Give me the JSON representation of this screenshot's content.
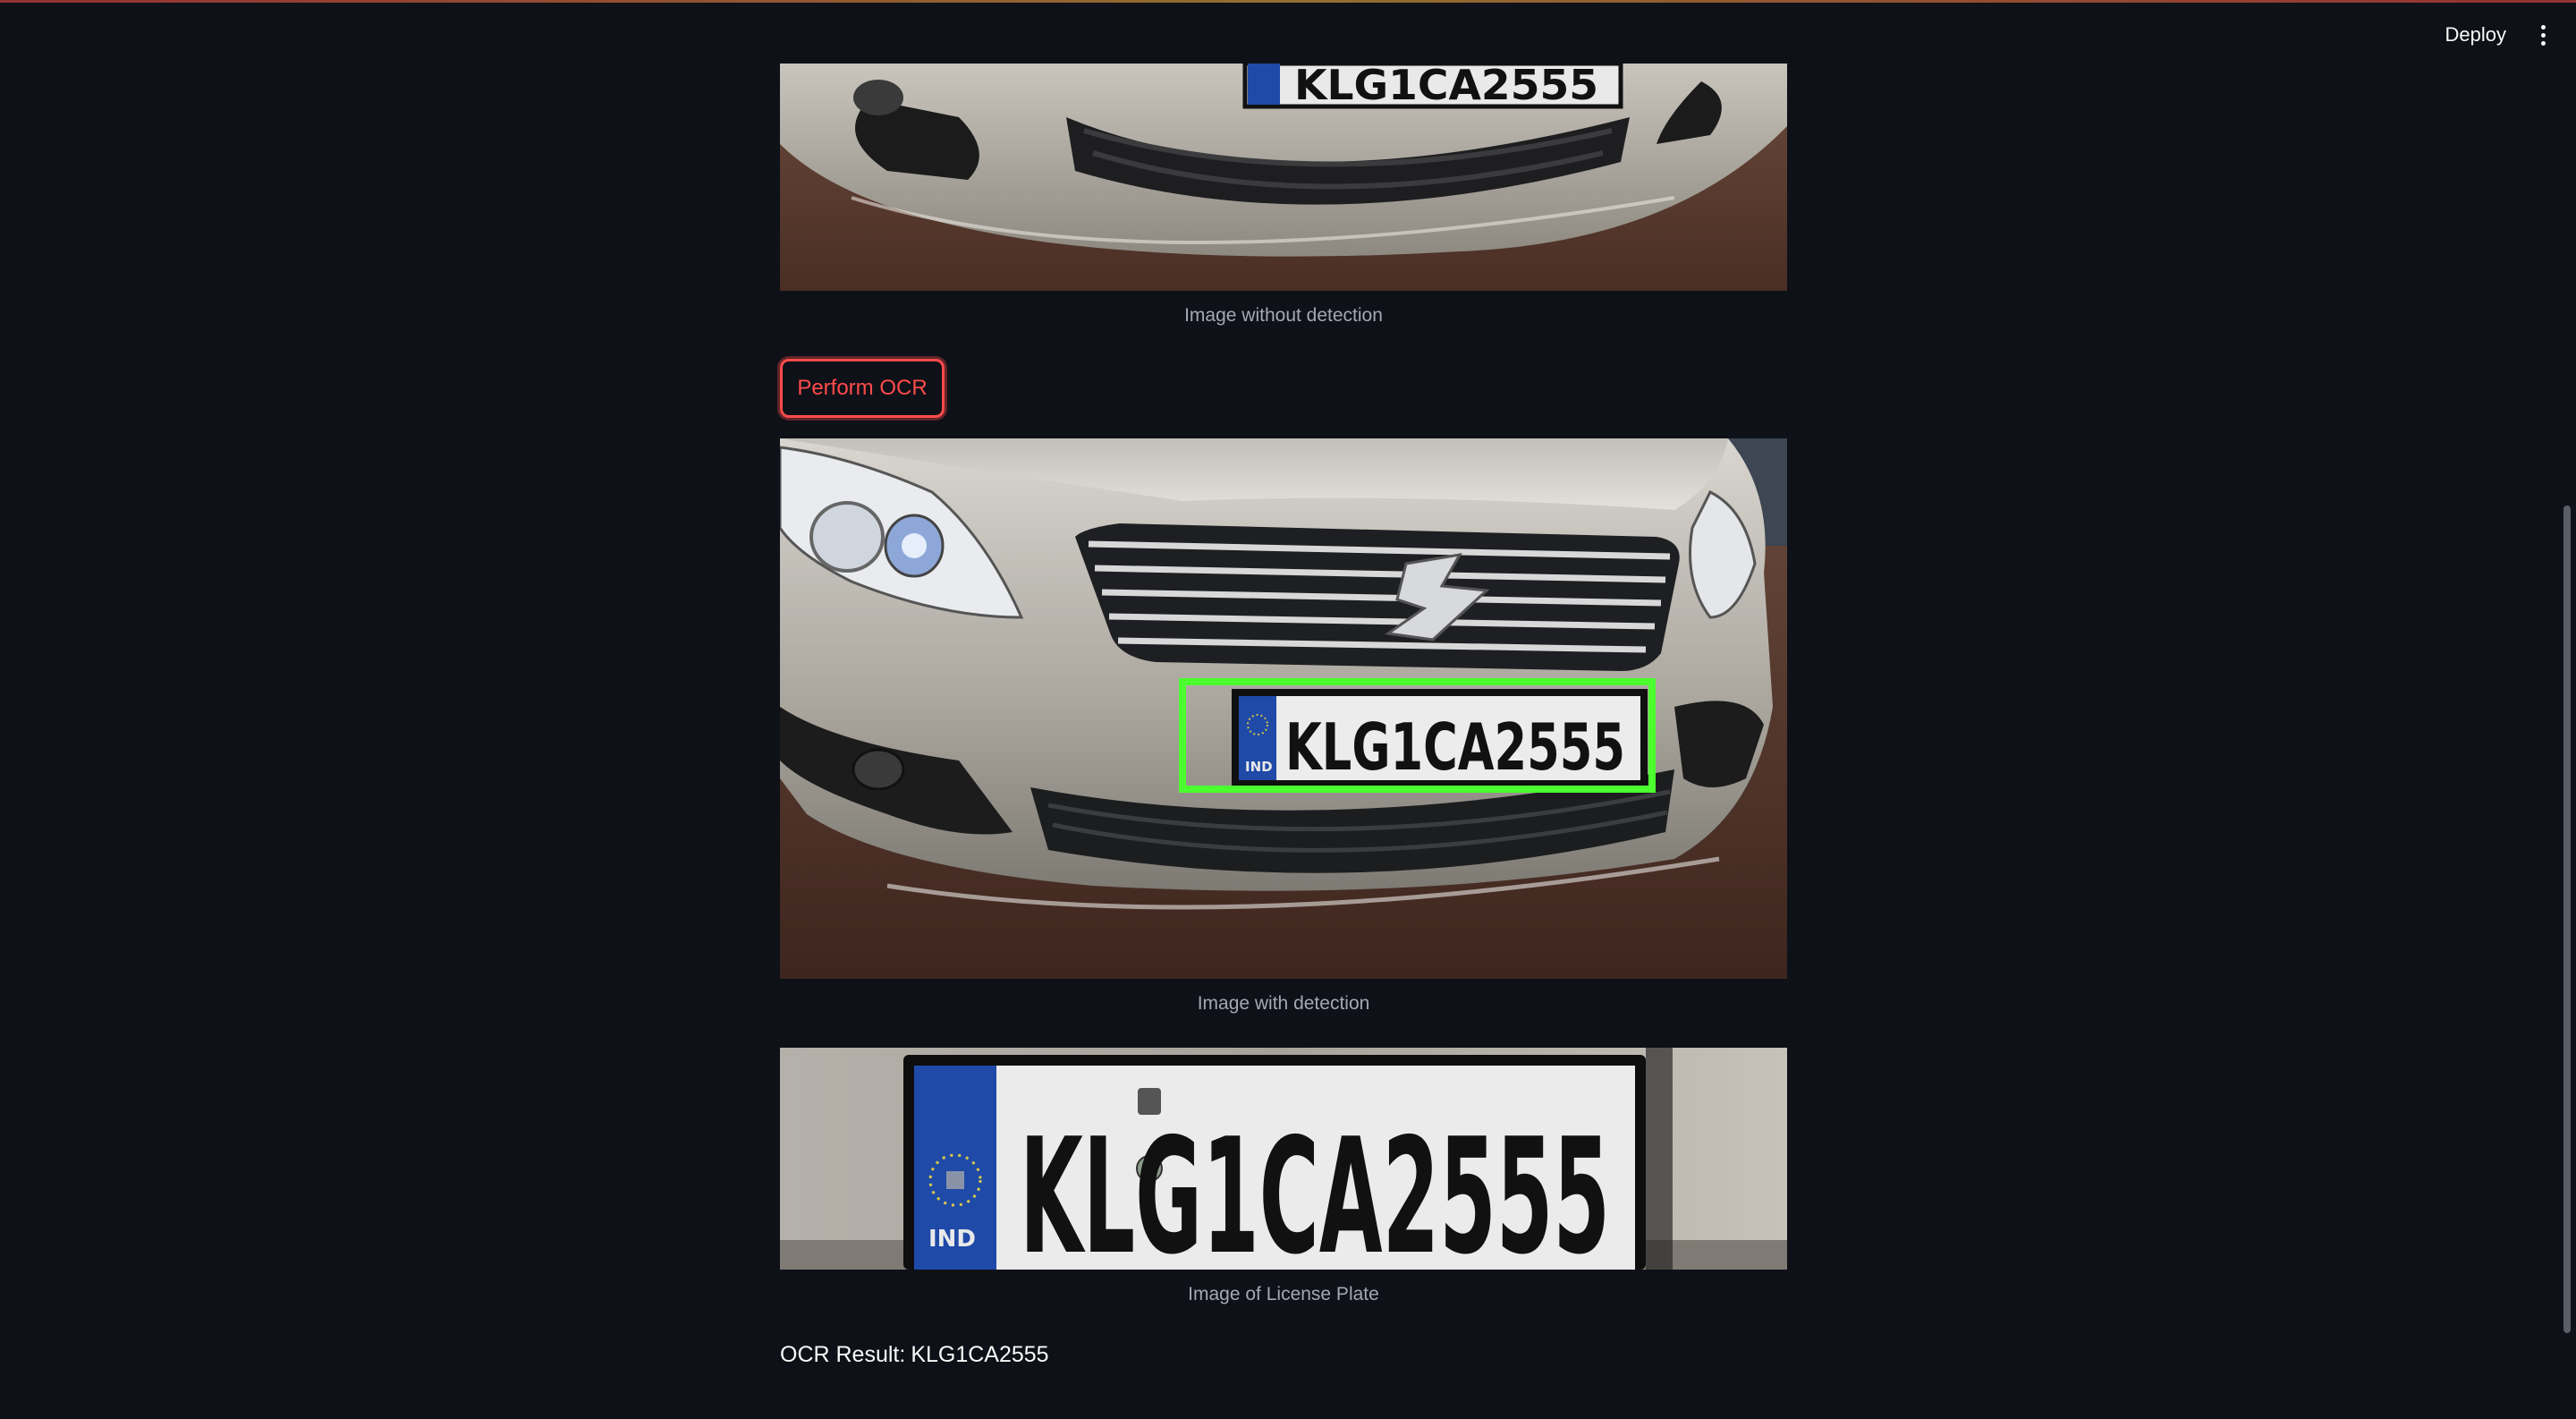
{
  "header": {
    "deploy_label": "Deploy",
    "menu_icon": "more-vertical-icon"
  },
  "images": {
    "no_detection_caption": "Image without detection",
    "with_detection_caption": "Image with detection",
    "plate_caption": "Image of License Plate"
  },
  "actions": {
    "ocr_button_label": "Perform OCR"
  },
  "plate": {
    "text": "KLG1CA2555",
    "country": "IND"
  },
  "result": {
    "label": "OCR Result:",
    "value": "KLG1CA2555"
  },
  "colors": {
    "background": "#0e1117",
    "accent": "#ff4b4b",
    "detection_box": "#4cff2e"
  }
}
